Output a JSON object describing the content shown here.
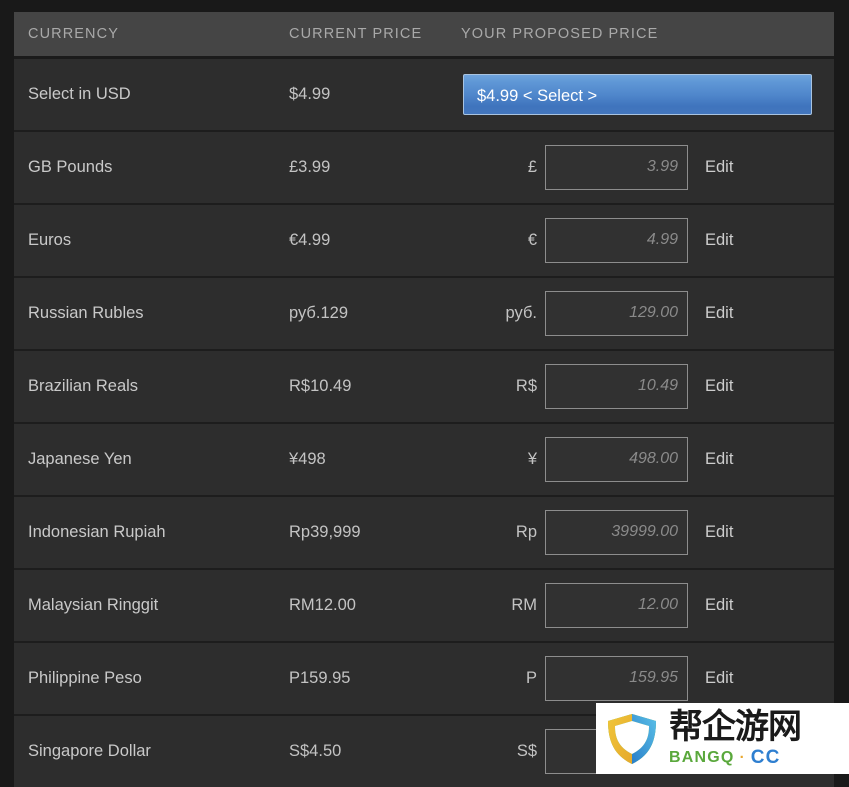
{
  "table": {
    "columns": {
      "currency": "CURRENCY",
      "current_price": "CURRENT PRICE",
      "proposed_price": "YOUR PROPOSED PRICE"
    },
    "edit_label": "Edit",
    "accent_color": "#4f86cb",
    "row_background": "#2d2d2d",
    "header_background": "#454545",
    "rows": [
      {
        "currency": "Select in USD",
        "current_price": "$4.99",
        "symbol": "",
        "placeholder": "",
        "select_label": "$4.99 < Select >",
        "selected": true
      },
      {
        "currency": "GB Pounds",
        "current_price": "£3.99",
        "symbol": "£",
        "placeholder": "3.99",
        "selected": false
      },
      {
        "currency": "Euros",
        "current_price": "€4.99",
        "symbol": "€",
        "placeholder": "4.99",
        "selected": false
      },
      {
        "currency": "Russian Rubles",
        "current_price": "руб.129",
        "symbol": "руб.",
        "placeholder": "129.00",
        "selected": false
      },
      {
        "currency": "Brazilian Reals",
        "current_price": "R$10.49",
        "symbol": "R$",
        "placeholder": "10.49",
        "selected": false
      },
      {
        "currency": "Japanese Yen",
        "current_price": "¥498",
        "symbol": "¥",
        "placeholder": "498.00",
        "selected": false
      },
      {
        "currency": "Indonesian Rupiah",
        "current_price": "Rp39,999",
        "symbol": "Rp",
        "placeholder": "39999.00",
        "selected": false
      },
      {
        "currency": "Malaysian Ringgit",
        "current_price": "RM12.00",
        "symbol": "RM",
        "placeholder": "12.00",
        "selected": false
      },
      {
        "currency": "Philippine Peso",
        "current_price": "P159.95",
        "symbol": "P",
        "placeholder": "159.95",
        "selected": false
      },
      {
        "currency": "Singapore Dollar",
        "current_price": "S$4.50",
        "symbol": "S$",
        "placeholder": "",
        "selected": false
      }
    ]
  },
  "watermark": {
    "chinese_text": "帮企游网",
    "brand": "BANGQ",
    "separator": "·",
    "suffix": "CC"
  }
}
